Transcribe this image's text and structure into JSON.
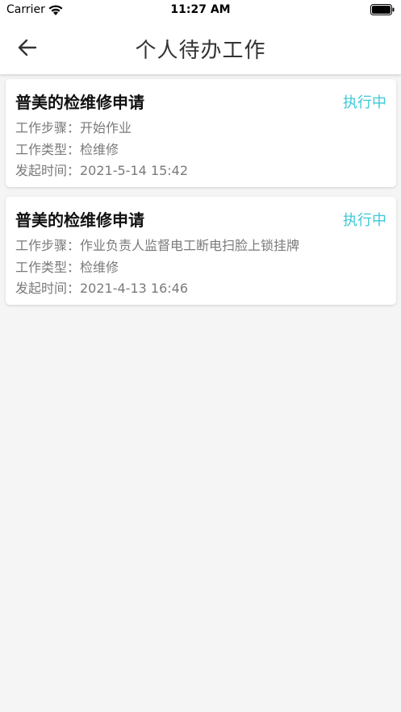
{
  "status_bar": {
    "carrier": "Carrier",
    "time": "11:27 AM"
  },
  "header": {
    "title": "个人待办工作",
    "back_icon": "arrow-left-icon"
  },
  "colors": {
    "status_accent": "#3ec9d6",
    "title_text": "#111111",
    "secondary_text": "#7a7a7a",
    "background": "#f5f5f5"
  },
  "tasks": [
    {
      "title": "普美的检维修申请",
      "status": "执行中",
      "step": "工作步骤：开始作业",
      "type": "工作类型：检维修",
      "start_time": "发起时间：2021-5-14 15:42"
    },
    {
      "title": "普美的检维修申请",
      "status": "执行中",
      "step": "工作步骤：作业负责人监督电工断电扫脸上锁挂牌",
      "type": "工作类型：检维修",
      "start_time": "发起时间：2021-4-13 16:46"
    }
  ]
}
